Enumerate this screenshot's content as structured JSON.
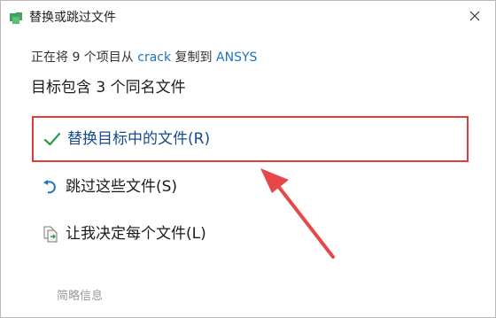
{
  "window": {
    "title": "替换或跳过文件",
    "icons": {
      "app": "file-copy-app-icon",
      "close": "close-icon"
    }
  },
  "copy_status": {
    "prefix": "正在将 9 个项目从 ",
    "source": "crack",
    "middle": " 复制到 ",
    "destination": "ANSYS"
  },
  "heading": "目标包含 3 个同名文件",
  "options": [
    {
      "label": "替换目标中的文件(R)",
      "icon": "checkmark-icon",
      "highlighted": true
    },
    {
      "label": "跳过这些文件(S)",
      "icon": "skip-arrow-icon"
    },
    {
      "label": "让我决定每个文件(L)",
      "icon": "compare-files-icon"
    }
  ],
  "details_link": "简略信息",
  "colors": {
    "accent": "#1e73be",
    "check": "#2c9a4c",
    "highlight_border": "#e03c3c",
    "annotation_arrow": "#e8474a"
  }
}
